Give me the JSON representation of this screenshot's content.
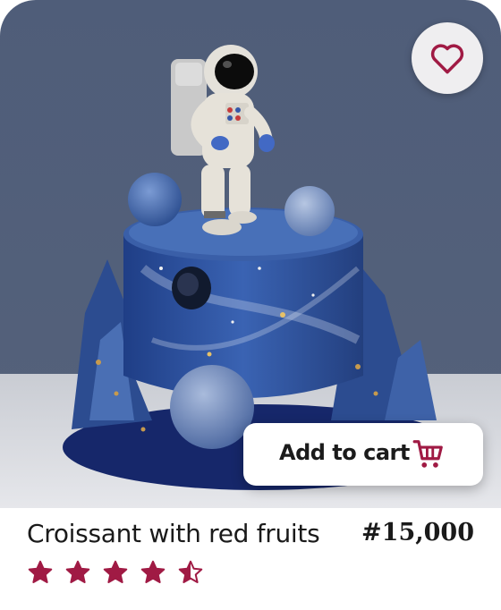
{
  "product": {
    "title": "Croissant with red fruits",
    "price": "#15,000",
    "rating": 4.5,
    "rating_max": 5,
    "image_subject": "space-themed cake with astronaut figure"
  },
  "actions": {
    "add_to_cart_label": "Add to cart",
    "cart_icon": "shopping-cart-icon",
    "favorite_icon": "heart-icon"
  },
  "colors": {
    "accent": "#a01a44",
    "card_background": "#ffffff",
    "favorite_button_bg": "#efeef0",
    "text": "#1a1a1a"
  }
}
